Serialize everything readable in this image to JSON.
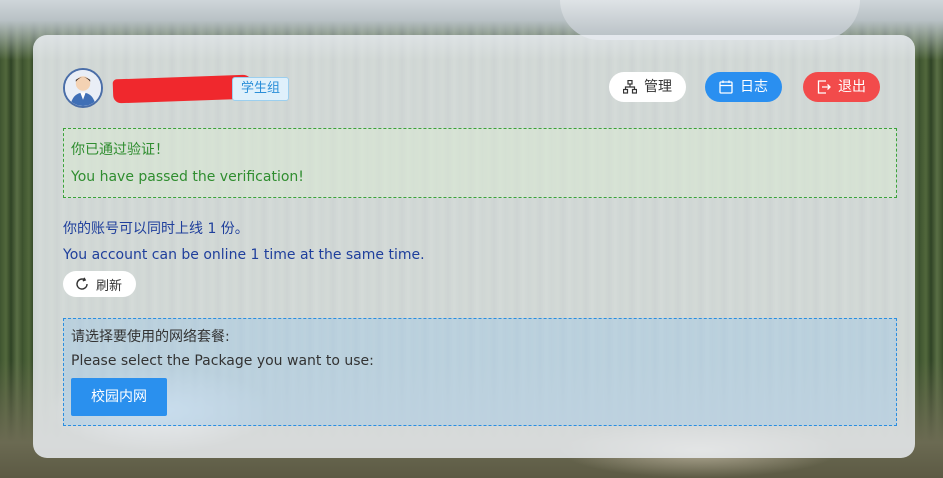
{
  "header": {
    "group_tag": "学生组",
    "buttons": {
      "manage": "管理",
      "log": "日志",
      "logout": "退出"
    }
  },
  "verification": {
    "message_zh": "你已通过验证！",
    "message_en": "You have passed the verification!"
  },
  "online": {
    "message_zh": "你的账号可以同时上线 1 份。",
    "message_en": "You account can be online 1 time at the same time.",
    "refresh_label": "刷新"
  },
  "package": {
    "prompt_zh": "请选择要使用的网络套餐:",
    "prompt_en": "Please select the Package you want to use:",
    "options": [
      "校园内网"
    ]
  },
  "colors": {
    "success": "#2f8d2f",
    "primary": "#2a8ff0",
    "danger": "#f24b4b",
    "info_text": "#1f3f9c"
  },
  "icons": {
    "manage": "sitemap-icon",
    "log": "calendar-icon",
    "logout": "logout-icon",
    "refresh": "refresh-icon"
  }
}
